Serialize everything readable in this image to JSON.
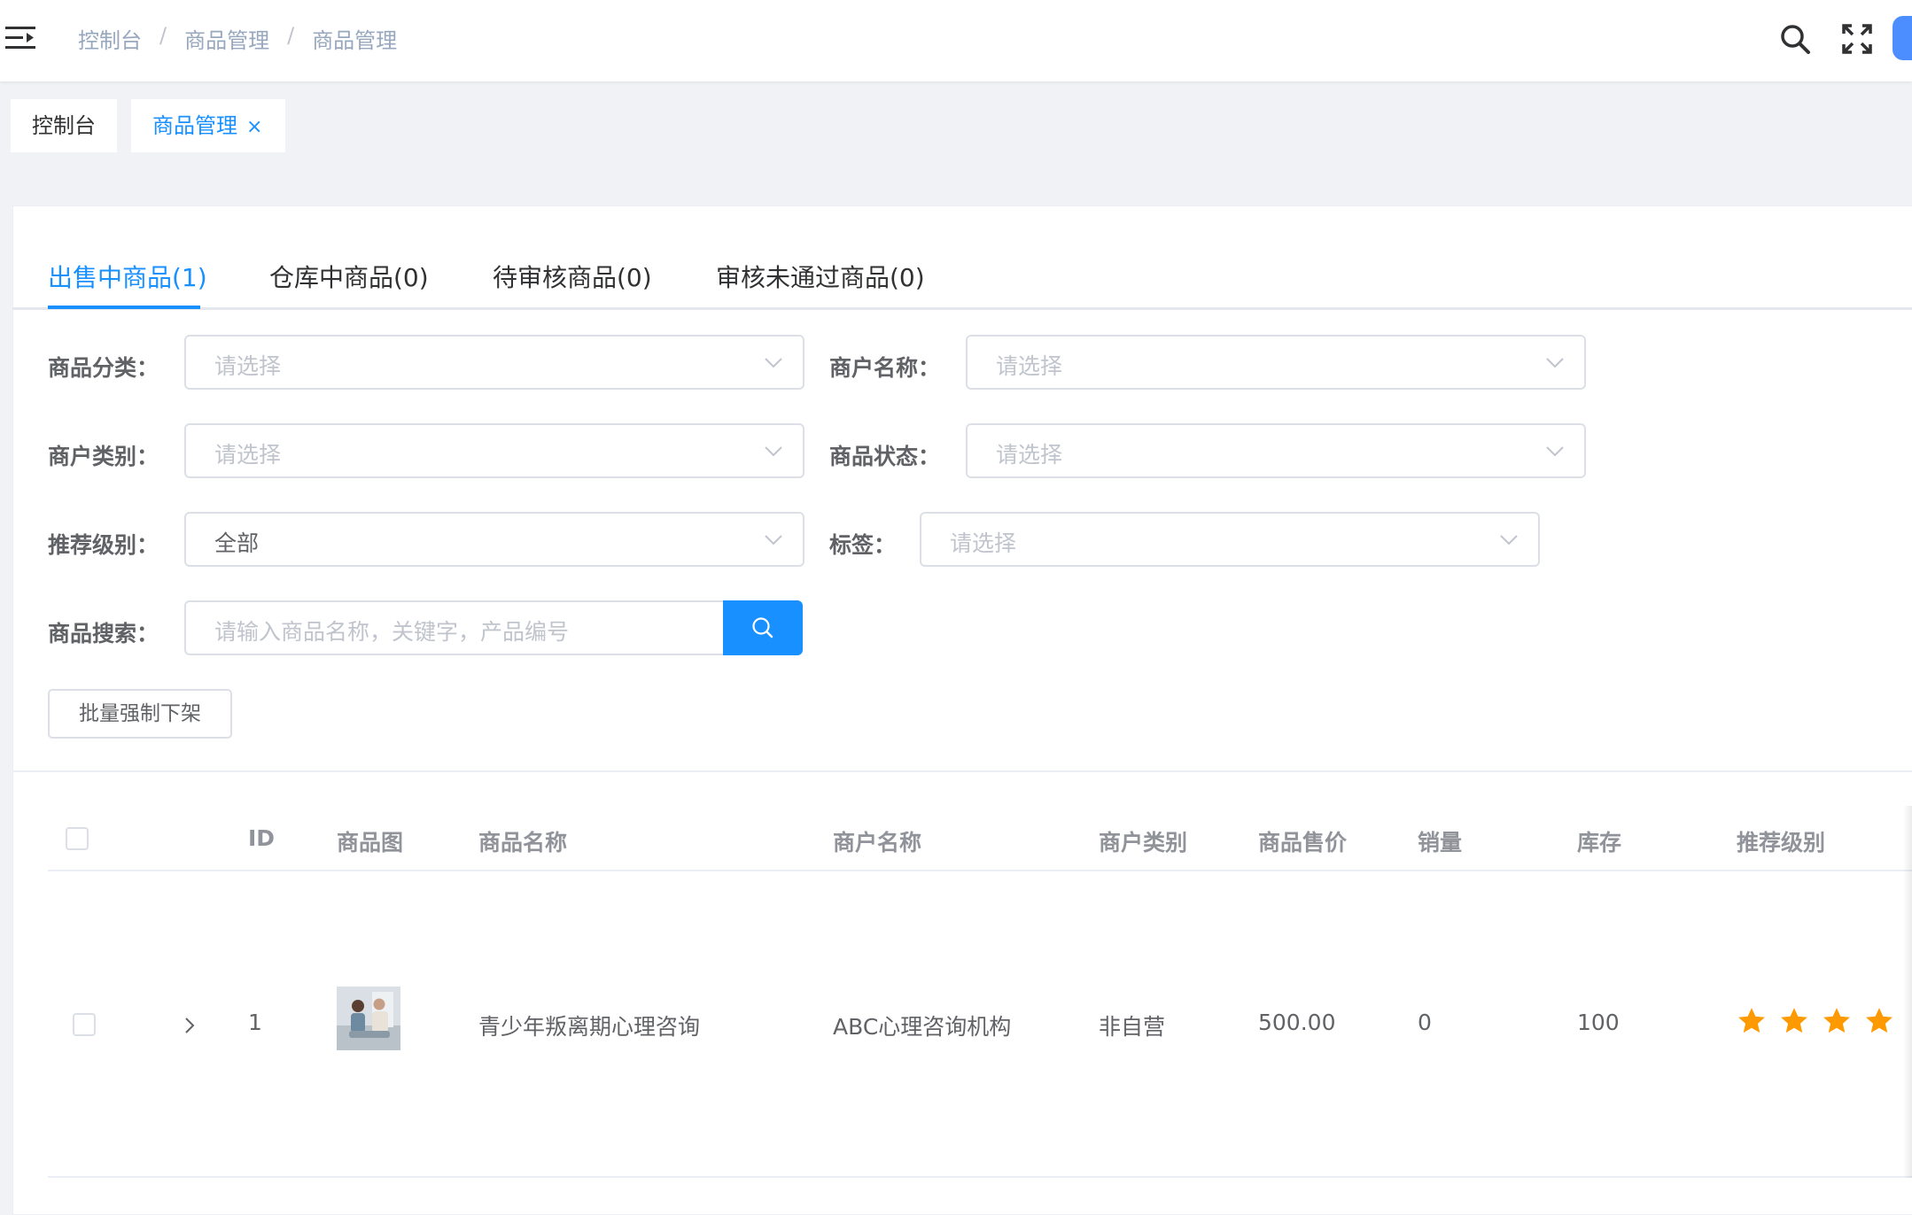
{
  "breadcrumb": [
    "控制台",
    "商品管理",
    "商品管理"
  ],
  "breadcrumb_sep": "/",
  "tags_view": [
    {
      "label": "控制台"
    },
    {
      "label": "商品管理",
      "close": "×"
    }
  ],
  "tabs": [
    "出售中商品(1)",
    "仓库中商品(0)",
    "待审核商品(0)",
    "审核未通过商品(0)"
  ],
  "filters": {
    "category": {
      "label": "商品分类：",
      "placeholder": "请选择"
    },
    "merchant_name": {
      "label": "商户名称：",
      "placeholder": "请选择"
    },
    "merchant_type": {
      "label": "商户类别：",
      "placeholder": "请选择"
    },
    "status": {
      "label": "商品状态：",
      "placeholder": "请选择"
    },
    "recommend_level": {
      "label": "推荐级别：",
      "value": "全部"
    },
    "tags": {
      "label": "标签：",
      "placeholder": "请选择"
    },
    "search": {
      "label": "商品搜索：",
      "placeholder": "请输入商品名称，关键字，产品编号"
    }
  },
  "batch_button": "批量强制下架",
  "table": {
    "headers": [
      "ID",
      "商品图",
      "商品名称",
      "商户名称",
      "商户类别",
      "商品售价",
      "销量",
      "库存",
      "推荐级别"
    ],
    "rows": [
      {
        "id": "1",
        "name": "青少年叛离期心理咨询",
        "merchant": "ABC心理咨询机构",
        "merchant_type": "非自营",
        "price": "500.00",
        "sales": "0",
        "stock": "100",
        "stars": 4
      }
    ]
  },
  "colors": {
    "primary": "#1890ff",
    "star": "#ff9900"
  },
  "icons": [
    "menu-fold-icon",
    "search-icon",
    "fullscreen-icon",
    "close-icon",
    "chevron-down-icon",
    "chevron-right-icon",
    "star-icon"
  ]
}
